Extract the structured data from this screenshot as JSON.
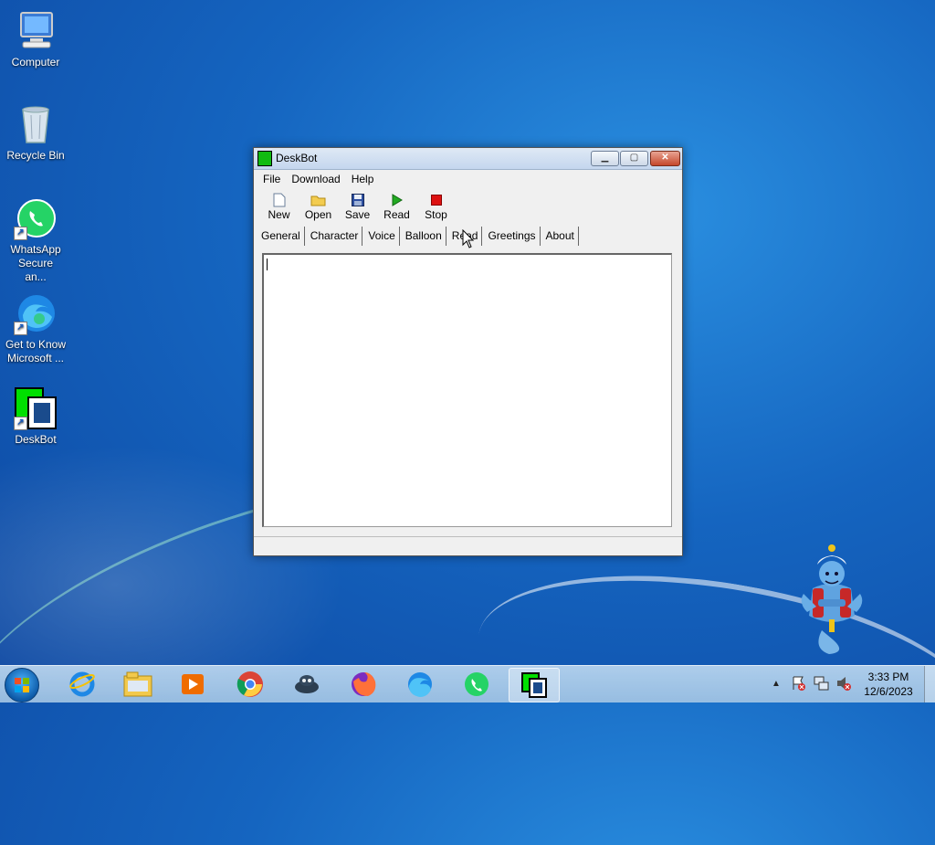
{
  "desktop": {
    "icons": [
      {
        "label": "Computer"
      },
      {
        "label": "Recycle Bin"
      },
      {
        "label": "WhatsApp Secure an..."
      },
      {
        "label": "Get to Know Microsoft ..."
      },
      {
        "label": "DeskBot"
      }
    ]
  },
  "window": {
    "title": "DeskBot",
    "menu": [
      "File",
      "Download",
      "Help"
    ],
    "toolbar": [
      {
        "label": "New",
        "icon": "new-document-icon"
      },
      {
        "label": "Open",
        "icon": "open-folder-icon"
      },
      {
        "label": "Save",
        "icon": "floppy-disk-icon"
      },
      {
        "label": "Read",
        "icon": "play-icon"
      },
      {
        "label": "Stop",
        "icon": "stop-icon"
      }
    ],
    "tabs": [
      "General",
      "Character",
      "Voice",
      "Balloon",
      "Read",
      "Greetings",
      "About"
    ],
    "active_tab": "Read",
    "text_content": ""
  },
  "taskbar": {
    "apps": [
      "windows-explorer",
      "internet-explorer",
      "file-explorer",
      "media-player",
      "chrome",
      "cyberduck",
      "firefox",
      "edge",
      "whatsapp",
      "deskbot"
    ],
    "clock_time": "3:33 PM",
    "clock_date": "12/6/2023"
  },
  "colors": {
    "accent": "#1565c0",
    "play": "#22aa22",
    "stop": "#dd1111"
  }
}
